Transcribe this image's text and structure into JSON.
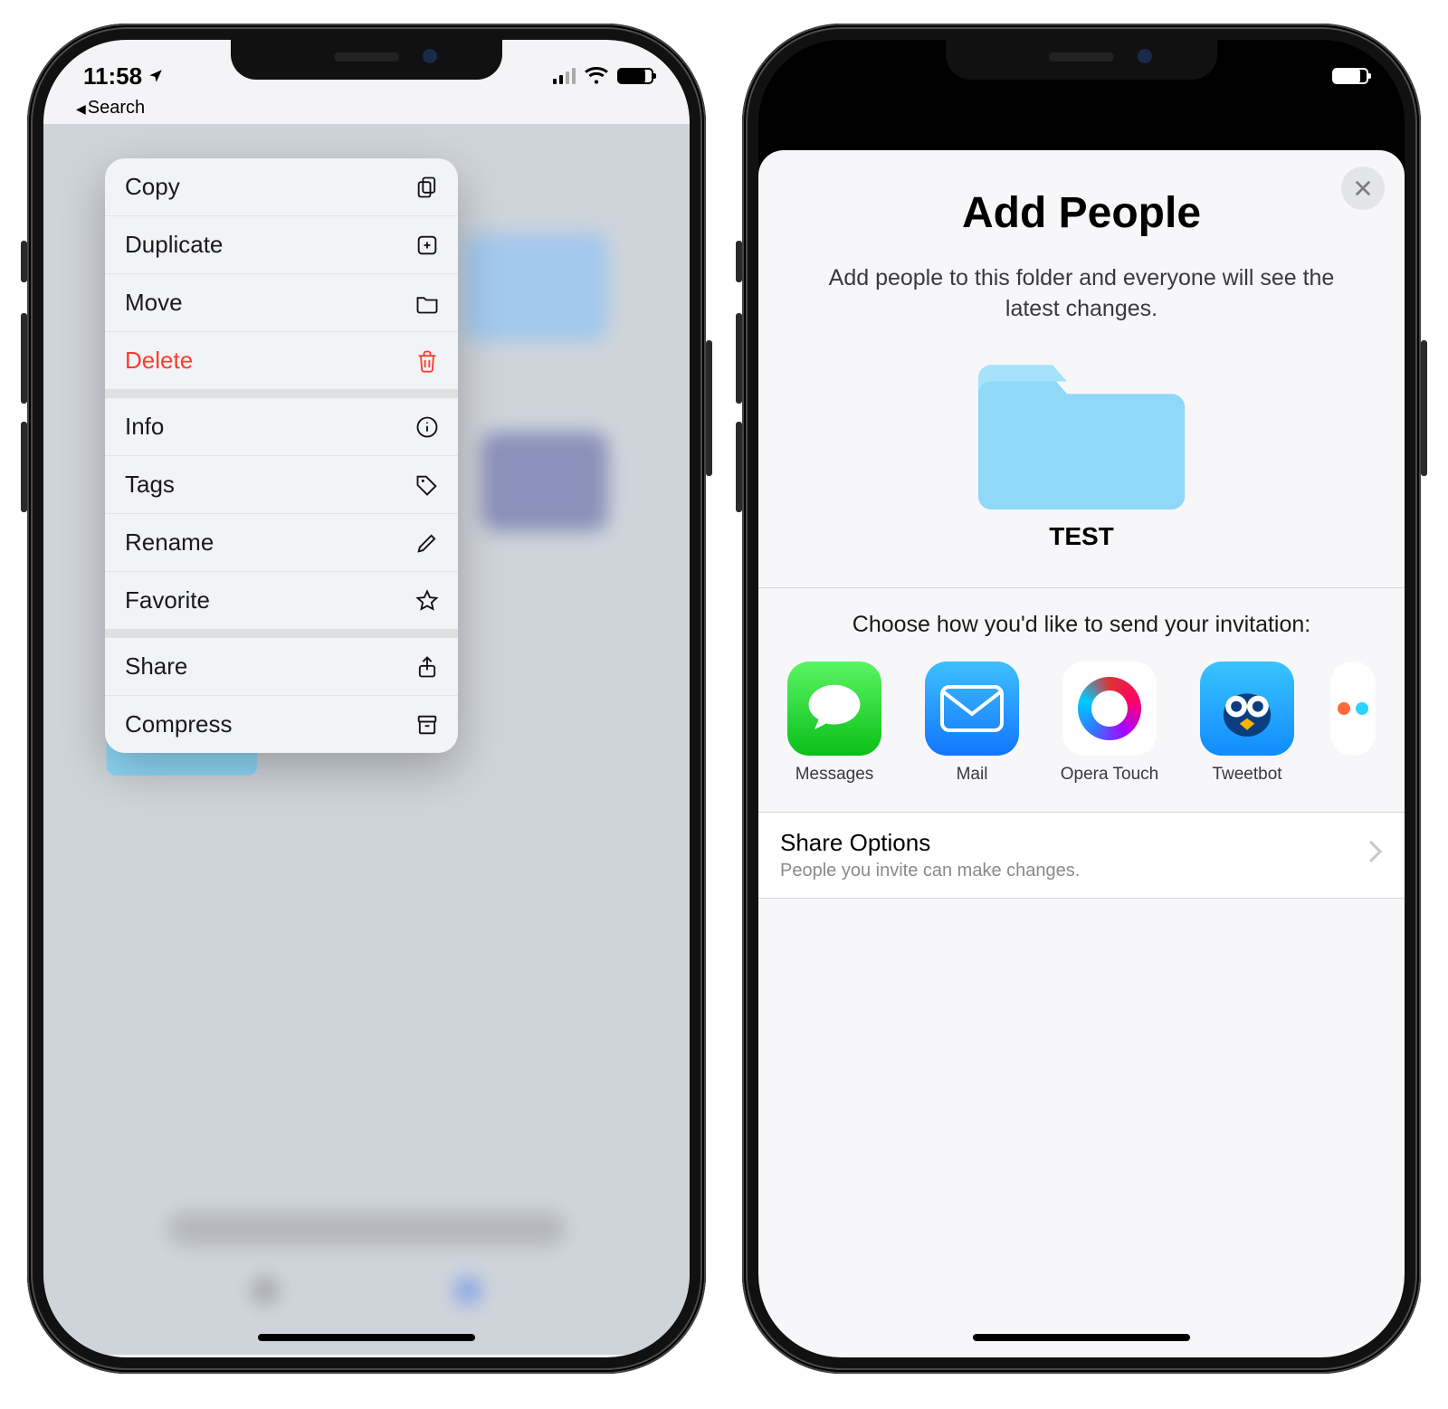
{
  "status": {
    "time": "11:58",
    "back_label": "Search"
  },
  "context_menu": [
    {
      "id": "copy",
      "label": "Copy",
      "icon": "copy-icon",
      "danger": false,
      "sep": false
    },
    {
      "id": "duplicate",
      "label": "Duplicate",
      "icon": "duplicate-icon",
      "danger": false,
      "sep": false
    },
    {
      "id": "move",
      "label": "Move",
      "icon": "folder-icon",
      "danger": false,
      "sep": false
    },
    {
      "id": "delete",
      "label": "Delete",
      "icon": "trash-icon",
      "danger": true,
      "sep": true
    },
    {
      "id": "info",
      "label": "Info",
      "icon": "info-icon",
      "danger": false,
      "sep": false
    },
    {
      "id": "tags",
      "label": "Tags",
      "icon": "tag-icon",
      "danger": false,
      "sep": false
    },
    {
      "id": "rename",
      "label": "Rename",
      "icon": "pencil-icon",
      "danger": false,
      "sep": false
    },
    {
      "id": "favorite",
      "label": "Favorite",
      "icon": "star-icon",
      "danger": false,
      "sep": true
    },
    {
      "id": "share",
      "label": "Share",
      "icon": "share-icon",
      "danger": false,
      "sep": false
    },
    {
      "id": "compress",
      "label": "Compress",
      "icon": "archive-icon",
      "danger": false,
      "sep": false
    }
  ],
  "share_sheet": {
    "title": "Add People",
    "subtitle": "Add people to this folder and everyone will see the latest changes.",
    "folder_name": "TEST",
    "choose_label": "Choose how you'd like to send your invitation:",
    "apps": [
      {
        "id": "messages",
        "label": "Messages"
      },
      {
        "id": "mail",
        "label": "Mail"
      },
      {
        "id": "operatouch",
        "label": "Opera Touch"
      },
      {
        "id": "tweetbot",
        "label": "Tweetbot"
      }
    ],
    "options": {
      "title": "Share Options",
      "subtitle": "People you invite can make changes."
    }
  }
}
